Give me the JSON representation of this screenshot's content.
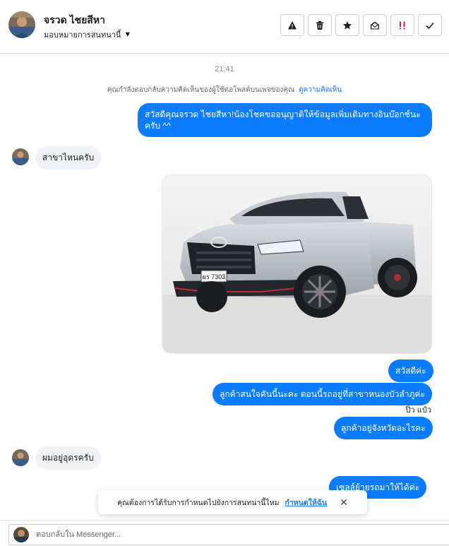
{
  "header": {
    "contact_name": "จรวด ไชยสีหา",
    "assign_label": "มอบหมายการสนทนานี้",
    "actions": [
      {
        "name": "report-icon",
        "title": "report"
      },
      {
        "name": "trash-icon",
        "title": "delete"
      },
      {
        "name": "star-icon",
        "title": "star"
      },
      {
        "name": "mark-unread-icon",
        "title": "mark unread"
      },
      {
        "name": "spam-icon",
        "title": "spam"
      },
      {
        "name": "check-icon",
        "title": "done"
      }
    ]
  },
  "chat": {
    "timestamp": "21:41",
    "context_text": "คุณกำลังตอบกลับความคิดเห็นของผู้ใช้ต่อโพสต์บนเพจของคุณ",
    "context_link": "ดูความคิดเห็น",
    "messages": {
      "m1": "สวัสดีคุณจรวด ไชยสีหา!น้องโชคขออนุญาติให้ข้อมูลเพิ่มเติมทางอินบ๊อกซ์นะครับ ^^",
      "m2": "สาขาไหนครับ",
      "m3": "สวัสดีค่ะ",
      "m4": "ลูกค้าสนใจคันนี้นะคะ  ตอนนี้รถอยู่ที่สาขาหนองบัวลำภูค่ะ",
      "sender": "ปิ๋ว แป๋ว",
      "m5": "ลูกค้าอยู่จังหวัดอะไรคะ",
      "m6": "ผมอยู่อุดรครับ",
      "m7": "เซลล์ย้ายรถมาให้ได้ค่ะ"
    },
    "photo_plate": "ผร 7303"
  },
  "banner": {
    "text": "คุณต้องการได้รับการกำหนดไปยังการสนทนานี้ไหม",
    "link": "กำหนดให้ฉัน",
    "close": "✕"
  },
  "composer": {
    "placeholder": "ตอบกลับใน Messenger..."
  },
  "colors": {
    "accent": "#0a7cff",
    "link": "#1877f2",
    "spam": "#e41e3f"
  }
}
